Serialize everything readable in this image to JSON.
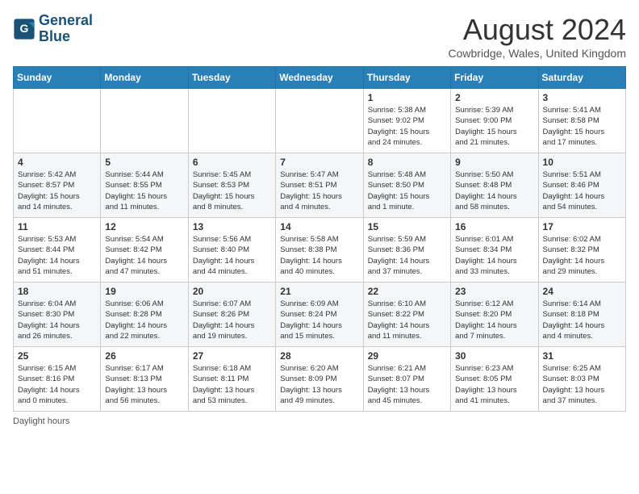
{
  "logo": {
    "line1": "General",
    "line2": "Blue"
  },
  "title": "August 2024",
  "location": "Cowbridge, Wales, United Kingdom",
  "days_of_week": [
    "Sunday",
    "Monday",
    "Tuesday",
    "Wednesday",
    "Thursday",
    "Friday",
    "Saturday"
  ],
  "footer": "Daylight hours",
  "weeks": [
    [
      {
        "num": "",
        "detail": ""
      },
      {
        "num": "",
        "detail": ""
      },
      {
        "num": "",
        "detail": ""
      },
      {
        "num": "",
        "detail": ""
      },
      {
        "num": "1",
        "detail": "Sunrise: 5:38 AM\nSunset: 9:02 PM\nDaylight: 15 hours\nand 24 minutes."
      },
      {
        "num": "2",
        "detail": "Sunrise: 5:39 AM\nSunset: 9:00 PM\nDaylight: 15 hours\nand 21 minutes."
      },
      {
        "num": "3",
        "detail": "Sunrise: 5:41 AM\nSunset: 8:58 PM\nDaylight: 15 hours\nand 17 minutes."
      }
    ],
    [
      {
        "num": "4",
        "detail": "Sunrise: 5:42 AM\nSunset: 8:57 PM\nDaylight: 15 hours\nand 14 minutes."
      },
      {
        "num": "5",
        "detail": "Sunrise: 5:44 AM\nSunset: 8:55 PM\nDaylight: 15 hours\nand 11 minutes."
      },
      {
        "num": "6",
        "detail": "Sunrise: 5:45 AM\nSunset: 8:53 PM\nDaylight: 15 hours\nand 8 minutes."
      },
      {
        "num": "7",
        "detail": "Sunrise: 5:47 AM\nSunset: 8:51 PM\nDaylight: 15 hours\nand 4 minutes."
      },
      {
        "num": "8",
        "detail": "Sunrise: 5:48 AM\nSunset: 8:50 PM\nDaylight: 15 hours\nand 1 minute."
      },
      {
        "num": "9",
        "detail": "Sunrise: 5:50 AM\nSunset: 8:48 PM\nDaylight: 14 hours\nand 58 minutes."
      },
      {
        "num": "10",
        "detail": "Sunrise: 5:51 AM\nSunset: 8:46 PM\nDaylight: 14 hours\nand 54 minutes."
      }
    ],
    [
      {
        "num": "11",
        "detail": "Sunrise: 5:53 AM\nSunset: 8:44 PM\nDaylight: 14 hours\nand 51 minutes."
      },
      {
        "num": "12",
        "detail": "Sunrise: 5:54 AM\nSunset: 8:42 PM\nDaylight: 14 hours\nand 47 minutes."
      },
      {
        "num": "13",
        "detail": "Sunrise: 5:56 AM\nSunset: 8:40 PM\nDaylight: 14 hours\nand 44 minutes."
      },
      {
        "num": "14",
        "detail": "Sunrise: 5:58 AM\nSunset: 8:38 PM\nDaylight: 14 hours\nand 40 minutes."
      },
      {
        "num": "15",
        "detail": "Sunrise: 5:59 AM\nSunset: 8:36 PM\nDaylight: 14 hours\nand 37 minutes."
      },
      {
        "num": "16",
        "detail": "Sunrise: 6:01 AM\nSunset: 8:34 PM\nDaylight: 14 hours\nand 33 minutes."
      },
      {
        "num": "17",
        "detail": "Sunrise: 6:02 AM\nSunset: 8:32 PM\nDaylight: 14 hours\nand 29 minutes."
      }
    ],
    [
      {
        "num": "18",
        "detail": "Sunrise: 6:04 AM\nSunset: 8:30 PM\nDaylight: 14 hours\nand 26 minutes."
      },
      {
        "num": "19",
        "detail": "Sunrise: 6:06 AM\nSunset: 8:28 PM\nDaylight: 14 hours\nand 22 minutes."
      },
      {
        "num": "20",
        "detail": "Sunrise: 6:07 AM\nSunset: 8:26 PM\nDaylight: 14 hours\nand 19 minutes."
      },
      {
        "num": "21",
        "detail": "Sunrise: 6:09 AM\nSunset: 8:24 PM\nDaylight: 14 hours\nand 15 minutes."
      },
      {
        "num": "22",
        "detail": "Sunrise: 6:10 AM\nSunset: 8:22 PM\nDaylight: 14 hours\nand 11 minutes."
      },
      {
        "num": "23",
        "detail": "Sunrise: 6:12 AM\nSunset: 8:20 PM\nDaylight: 14 hours\nand 7 minutes."
      },
      {
        "num": "24",
        "detail": "Sunrise: 6:14 AM\nSunset: 8:18 PM\nDaylight: 14 hours\nand 4 minutes."
      }
    ],
    [
      {
        "num": "25",
        "detail": "Sunrise: 6:15 AM\nSunset: 8:16 PM\nDaylight: 14 hours\nand 0 minutes."
      },
      {
        "num": "26",
        "detail": "Sunrise: 6:17 AM\nSunset: 8:13 PM\nDaylight: 13 hours\nand 56 minutes."
      },
      {
        "num": "27",
        "detail": "Sunrise: 6:18 AM\nSunset: 8:11 PM\nDaylight: 13 hours\nand 53 minutes."
      },
      {
        "num": "28",
        "detail": "Sunrise: 6:20 AM\nSunset: 8:09 PM\nDaylight: 13 hours\nand 49 minutes."
      },
      {
        "num": "29",
        "detail": "Sunrise: 6:21 AM\nSunset: 8:07 PM\nDaylight: 13 hours\nand 45 minutes."
      },
      {
        "num": "30",
        "detail": "Sunrise: 6:23 AM\nSunset: 8:05 PM\nDaylight: 13 hours\nand 41 minutes."
      },
      {
        "num": "31",
        "detail": "Sunrise: 6:25 AM\nSunset: 8:03 PM\nDaylight: 13 hours\nand 37 minutes."
      }
    ]
  ]
}
